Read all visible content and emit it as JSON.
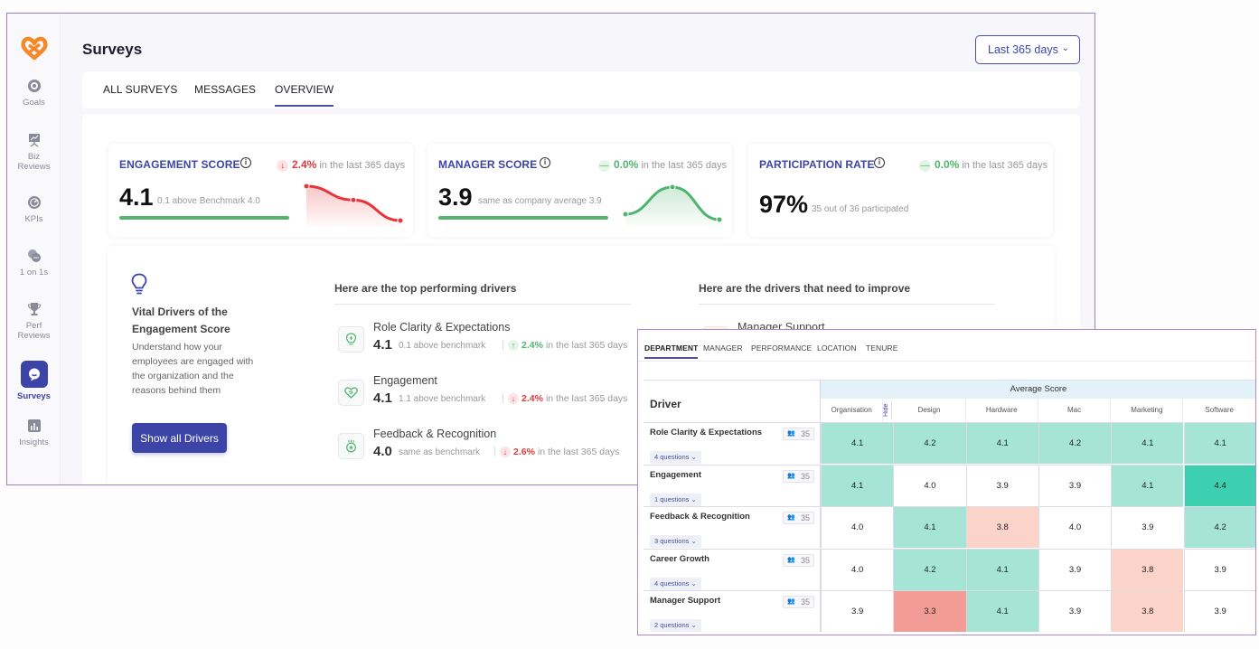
{
  "app": {
    "title": "Surveys",
    "date_range": "Last 365 days",
    "brand_color": "#3d44a8",
    "logo_color": "#f5892a"
  },
  "sidebar": {
    "items": [
      {
        "label": "Goals",
        "icon": "target-icon"
      },
      {
        "label": "Biz Reviews",
        "icon": "presentation-board-icon"
      },
      {
        "label": "KPIs",
        "icon": "gauge-icon"
      },
      {
        "label": "1 on 1s",
        "icon": "chat-bubbles-icon"
      },
      {
        "label": "Perf Reviews",
        "icon": "trophy-icon"
      },
      {
        "label": "Surveys",
        "icon": "survey-bubble-icon",
        "active": true
      },
      {
        "label": "Insights",
        "icon": "bar-chart-icon"
      }
    ]
  },
  "tabs": [
    {
      "label": "ALL SURVEYS"
    },
    {
      "label": "MESSAGES"
    },
    {
      "label": "OVERVIEW",
      "active": true
    }
  ],
  "scores": {
    "engagement": {
      "title": "ENGAGEMENT SCORE",
      "trend_dir": "down",
      "trend_arrow": "↓",
      "trend_value": "2.4%",
      "trend_text": "in the last 365 days",
      "value": "4.1",
      "sub": "0.1 above Benchmark 4.0",
      "sparkline": [
        4.2,
        4.1,
        3.95
      ]
    },
    "manager": {
      "title": "MANAGER SCORE",
      "trend_dir": "flat",
      "trend_arrow": "—",
      "trend_value": "0.0%",
      "trend_text": "in the last 365 days",
      "value": "3.9",
      "sub": "same as company average 3.9",
      "sparkline": [
        3.85,
        4.0,
        3.82
      ]
    },
    "participation": {
      "title": "PARTICIPATION RATE",
      "trend_dir": "flat",
      "trend_arrow": "—",
      "trend_value": "0.0%",
      "trend_text": "in the last 365 days",
      "value": "97%",
      "sub": "35 out of 36 participated"
    }
  },
  "vital_drivers": {
    "title": "Vital Drivers of the Engagement Score",
    "description": "Understand how your employees are engaged with the organization and the reasons behind them",
    "button": "Show all Drivers",
    "top_heading": "Here are the top performing drivers",
    "improve_heading": "Here are the drivers that need to improve",
    "top": [
      {
        "name": "Role Clarity & Expectations",
        "score": "4.1",
        "bench": "0.1 above benchmark",
        "dir": "up",
        "arrow": "↑",
        "change": "2.4%",
        "period": "in the last 365 days",
        "icon": "lightbulb-icon"
      },
      {
        "name": "Engagement",
        "score": "4.1",
        "bench": "1.1 above benchmark",
        "dir": "down",
        "arrow": "↓",
        "change": "2.4%",
        "period": "in the last 365 days",
        "icon": "heart-icon"
      },
      {
        "name": "Feedback & Recognition",
        "score": "4.0",
        "bench": "same as benchmark",
        "dir": "down",
        "arrow": "↓",
        "change": "2.6%",
        "period": "in the last 365 days",
        "icon": "medal-icon"
      }
    ],
    "improve": [
      {
        "name": "Manager Support"
      }
    ]
  },
  "heatmap": {
    "tabs": [
      "DEPARTMENT",
      "MANAGER",
      "PERFORMANCE",
      "LOCATION",
      "TENURE"
    ],
    "driver_header": "Driver",
    "group_header": "Average Score",
    "hide_label": "Hide",
    "columns": [
      "Organisation",
      "Design",
      "Hardware",
      "Mac",
      "Marketing",
      "Software"
    ],
    "rows": [
      {
        "driver": "Role Clarity & Expectations",
        "count": "35",
        "questions": "4 questions",
        "values": [
          "4.1",
          "4.2",
          "4.1",
          "4.2",
          "4.1",
          "4.1"
        ]
      },
      {
        "driver": "Engagement",
        "count": "35",
        "questions": "1 questions",
        "values": [
          "4.1",
          "4.0",
          "3.9",
          "3.9",
          "4.1",
          "4.4"
        ]
      },
      {
        "driver": "Feedback & Recognition",
        "count": "35",
        "questions": "3 questions",
        "values": [
          "4.0",
          "4.1",
          "3.8",
          "4.0",
          "3.9",
          "4.2"
        ]
      },
      {
        "driver": "Career Growth",
        "count": "35",
        "questions": "4 questions",
        "values": [
          "4.0",
          "4.2",
          "4.1",
          "3.9",
          "3.8",
          "3.9"
        ]
      },
      {
        "driver": "Manager Support",
        "count": "35",
        "questions": "2 questions",
        "values": [
          "3.9",
          "3.3",
          "4.1",
          "3.9",
          "3.8",
          "3.9"
        ]
      }
    ],
    "colors": {
      "high": "#3dd0b0",
      "good": "#a6e4d6",
      "neutral": "#ffffff",
      "low": "#fcd3c8",
      "very_low": "#f39b95"
    }
  }
}
